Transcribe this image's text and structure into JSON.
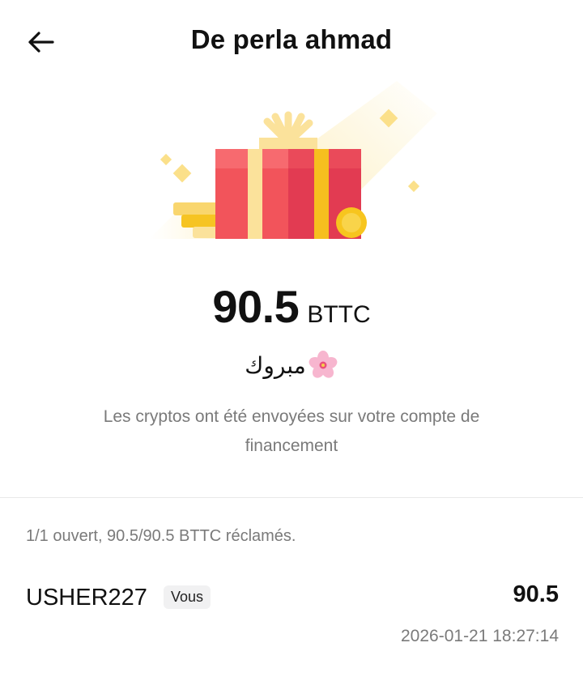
{
  "header": {
    "title": "De perla ahmad",
    "back_icon": "arrow-left-icon"
  },
  "illustration": {
    "icon": "gift-box-with-coins",
    "colors": {
      "box_red": "#f2545b",
      "box_dark": "#e23b52",
      "ribbon_light": "#fbe29b",
      "ribbon_gold": "#f6bf1f",
      "sparkle": "#fbe08a",
      "coin": "#f7c51e"
    }
  },
  "reward": {
    "amount": "90.5",
    "unit": "BTTC",
    "message": "مبروك",
    "message_icon": "cherry-blossom-icon",
    "info": "Les cryptos ont été envoyées sur votre compte de financement"
  },
  "claims": {
    "summary": "1/1 ouvert, 90.5/90.5 BTTC réclamés.",
    "items": [
      {
        "user": "USHER227",
        "badge": "Vous",
        "amount": "90.5",
        "timestamp": "2026-01-21 18:27:14"
      }
    ]
  }
}
